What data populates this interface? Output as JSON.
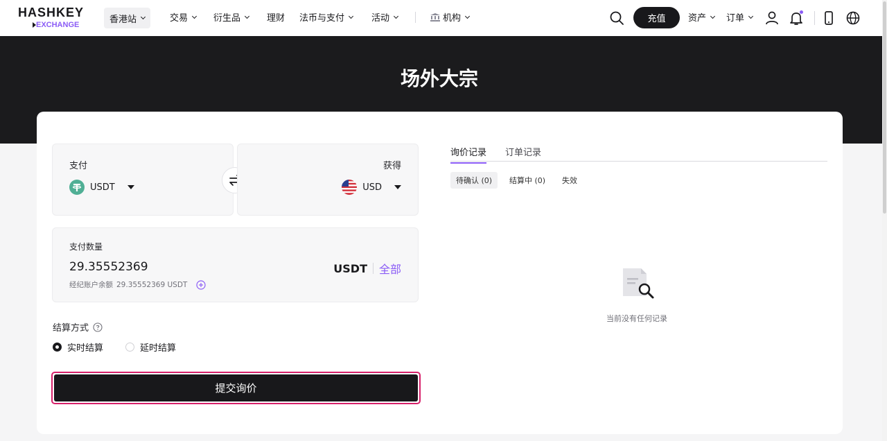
{
  "brand": {
    "logo_top": "HASHKEY",
    "logo_bottom": "EXCHANGE"
  },
  "nav": {
    "region": "香港站",
    "menu": [
      "交易",
      "衍生品",
      "理财",
      "法币与支付",
      "活动",
      "机构"
    ],
    "deposit": "充值",
    "assets": "资产",
    "orders": "订单"
  },
  "hero": {
    "title": "场外大宗"
  },
  "pay": {
    "label": "支付",
    "coin": "USDT"
  },
  "receive": {
    "label": "获得",
    "coin": "USD"
  },
  "amount": {
    "label": "支付数量",
    "value": "29.35552369",
    "unit": "USDT",
    "all": "全部",
    "balance_label": "经纪账户余额",
    "balance_value": "29.35552369 USDT"
  },
  "settlement": {
    "label": "结算方式",
    "options": [
      "实时结算",
      "延时结算"
    ],
    "selected": "实时结算"
  },
  "submit": "提交询价",
  "records": {
    "tabs": [
      "询价记录",
      "订单记录"
    ],
    "active_tab": "询价记录",
    "subtabs": [
      "待确认 (0)",
      "结算中 (0)",
      "失效"
    ],
    "empty": "当前没有任何记录"
  },
  "colors": {
    "accent": "#8b5cf6",
    "dark": "#18181b",
    "highlight": "#d61f69"
  }
}
